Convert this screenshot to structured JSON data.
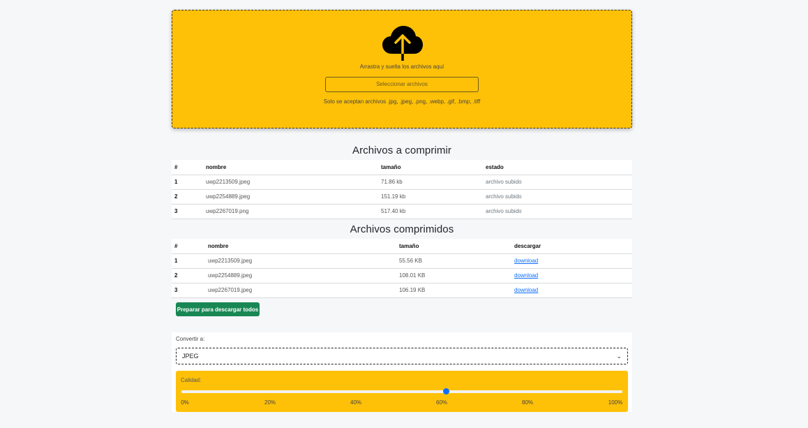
{
  "dropzone": {
    "icon": "cloud-upload-icon",
    "drop_text": "Arrastra y suelta los archivos aquí",
    "select_button": "Seleccionar archivos",
    "accept_text": "Solo se aceptan archivos .jpg, .jpeg, .png, .webp, .gif, .bmp, .tiff"
  },
  "uploaded": {
    "title": "Archivos a comprimir",
    "headers": [
      "#",
      "nombre",
      "tamaño",
      "estado"
    ],
    "rows": [
      {
        "num": "1",
        "name": "uwp2213509.jpeg",
        "size": "71.86 kb",
        "status": "archivo subido"
      },
      {
        "num": "2",
        "name": "uwp2254889.jpeg",
        "size": "151.19 kb",
        "status": "archivo subido"
      },
      {
        "num": "3",
        "name": "uwp2267019.png",
        "size": "517.40 kb",
        "status": "archivo subido"
      }
    ]
  },
  "compressed": {
    "title": "Archivos comprimidos",
    "headers": [
      "#",
      "nombre",
      "tamaño",
      "descargar"
    ],
    "rows": [
      {
        "num": "1",
        "name": "uwp2213509.jpeg",
        "size": "55.56 KB",
        "link": "download"
      },
      {
        "num": "2",
        "name": "uwp2254889.jpeg",
        "size": "108.01 KB",
        "link": "download"
      },
      {
        "num": "3",
        "name": "uwp2267019.jpeg",
        "size": "106.19 KB",
        "link": "download"
      }
    ]
  },
  "download_all_button": "Preparar para descargar todos",
  "convert": {
    "label": "Convertir a:",
    "selected": "JPEG"
  },
  "quality": {
    "label": "Calidad:",
    "value_percent": 60,
    "ticks": [
      "0%",
      "20%",
      "40%",
      "60%",
      "80%",
      "100%"
    ]
  },
  "colors": {
    "accent_yellow": "#ffc107",
    "success_green": "#198754",
    "link_blue": "#0d6efd"
  }
}
